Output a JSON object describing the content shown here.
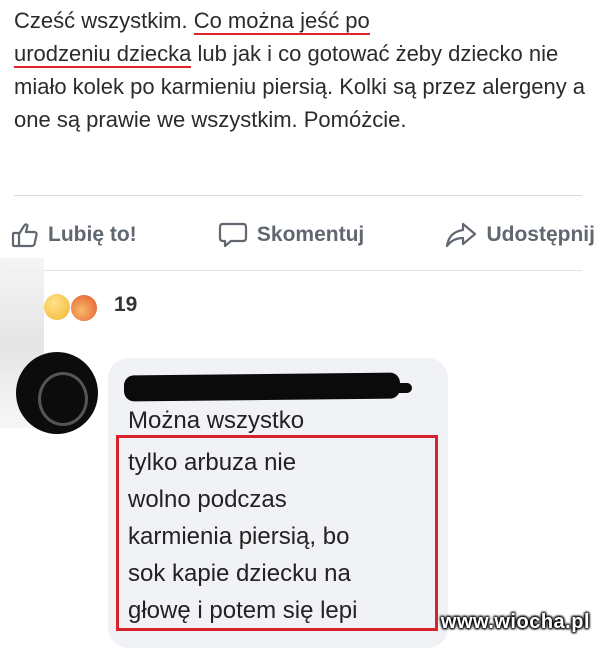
{
  "post": {
    "text_part1": "Cześć wszystkim. ",
    "text_underlined1": "Co można jeść po",
    "text_underlined2": "urodzeniu dziecka",
    "text_part2": " lub jak i co gotować żeby dziecko nie miało kolek po karmieniu piersią. Kolki są przez alergeny a one są prawie we wszystkim. Pomóżcie."
  },
  "actions": {
    "like_label": "Lubię to!",
    "comment_label": "Skomentuj",
    "share_label": "Udostępnij"
  },
  "reactions": {
    "count": "19"
  },
  "comment": {
    "first_line": "Można wszystko",
    "highlighted_lines": [
      "tylko arbuza nie",
      "wolno podczas",
      "karmienia piersią, bo",
      "sok kapie dziecku na",
      "głowę i potem się lepi"
    ]
  },
  "watermark": "www.wiocha.pl",
  "colors": {
    "highlight_red": "#d8232a",
    "action_gray": "#606770",
    "bubble_bg": "#f0f2f5"
  }
}
